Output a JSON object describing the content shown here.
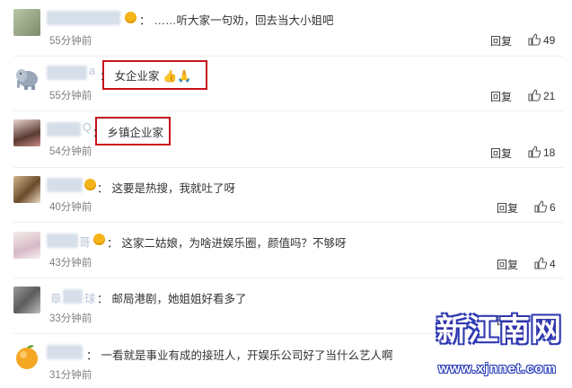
{
  "comments": [
    {
      "text": "……听大家一句劝，回去当大小姐吧",
      "time": "55分钟前",
      "reply": "回复",
      "likes": "49"
    },
    {
      "text": "女企业家",
      "emoji": "👍🙏",
      "time": "55分钟前",
      "reply": "回复",
      "likes": "21"
    },
    {
      "text": "乡镇企业家",
      "time": "54分钟前",
      "reply": "回复",
      "likes": "18"
    },
    {
      "text": "这要是热搜，我就吐了呀",
      "time": "40分钟前",
      "reply": "回复",
      "likes": "6"
    },
    {
      "text": "这家二姑娘，为啥进娱乐圈，颜值吗？不够呀",
      "time": "43分钟前",
      "reply": "回复",
      "likes": "4"
    },
    {
      "text": "邮局港剧，她姐姐好看多了",
      "time": "33分钟前",
      "reply": "回复",
      "likes": ""
    },
    {
      "text": "一看就是事业有成的接班人，开娱乐公司好了当什么艺人啊",
      "time": "31分钟前",
      "reply": "",
      "likes": ""
    }
  ],
  "name_fragments": {
    "c2": "a",
    "c3": "Q",
    "c5": "哥",
    "c6_left": "章",
    "c6_right": "球"
  },
  "watermark": {
    "title": "新江南网",
    "url": "www.xjnnet.com"
  },
  "colors": {
    "highlight_box": "#c8121c",
    "time": "#808080",
    "text": "#333333"
  }
}
